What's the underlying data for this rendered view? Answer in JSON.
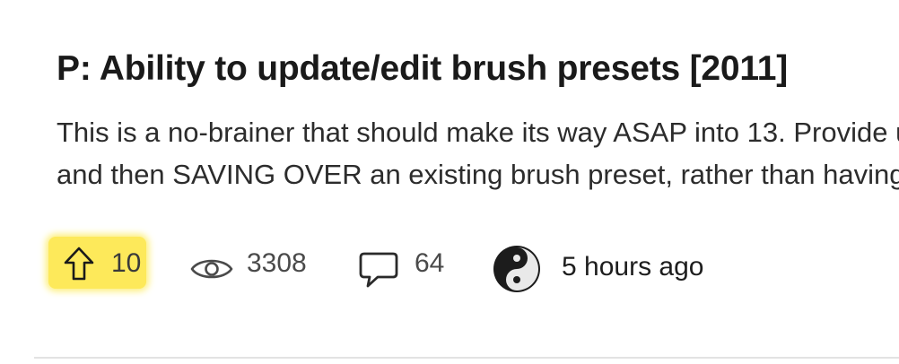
{
  "post": {
    "title": "P: Ability to update/edit brush presets [2011]",
    "excerpt_lines": [
      "This is a no-brainer that should make its way ASAP into 13. Provide u",
      "and then SAVING OVER an existing brush preset, rather than having"
    ]
  },
  "meta": {
    "votes": "10",
    "views": "3308",
    "comments": "64",
    "posted_time": "5 hours ago"
  },
  "icons": {
    "vote": "upvote-arrow-icon",
    "views": "eye-icon",
    "comments": "speech-bubble-icon",
    "avatar": "yin-yang-avatar"
  },
  "colors": {
    "vote_highlight": "#fde95a",
    "text": "#1b1b1b",
    "muted": "#4a4a4a"
  }
}
